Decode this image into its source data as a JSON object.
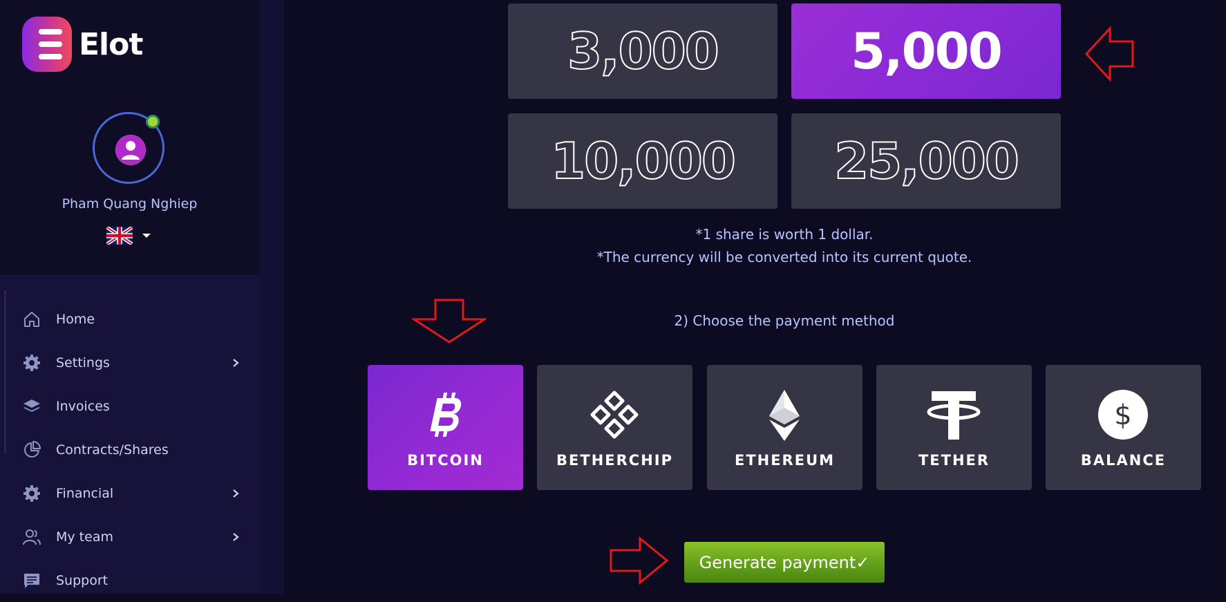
{
  "brand": {
    "name": "Elot"
  },
  "user": {
    "name": "Pham Quang Nghiep",
    "language": "English"
  },
  "sidebar": {
    "items": [
      {
        "label": "Home",
        "icon": "home-icon",
        "has_submenu": false
      },
      {
        "label": "Settings",
        "icon": "gear-icon",
        "has_submenu": true
      },
      {
        "label": "Invoices",
        "icon": "layers-icon",
        "has_submenu": false
      },
      {
        "label": "Contracts/Shares",
        "icon": "pie-chart-icon",
        "has_submenu": false
      },
      {
        "label": "Financial",
        "icon": "gear-icon",
        "has_submenu": true
      },
      {
        "label": "My team",
        "icon": "users-icon",
        "has_submenu": true
      },
      {
        "label": "Support",
        "icon": "chat-icon",
        "has_submenu": false
      }
    ]
  },
  "shares": {
    "options": [
      {
        "label": "3,000",
        "selected": false
      },
      {
        "label": "5,000",
        "selected": true
      },
      {
        "label": "10,000",
        "selected": false
      },
      {
        "label": "25,000",
        "selected": false
      }
    ],
    "note_1": "*1 share is worth 1 dollar.",
    "note_2": "*The currency will be converted into its current quote."
  },
  "payment": {
    "title": "2) Choose the payment method",
    "methods": [
      {
        "label": "BITCOIN",
        "icon": "bitcoin-icon",
        "selected": true
      },
      {
        "label": "BETHERCHIP",
        "icon": "betherchip-icon",
        "selected": false
      },
      {
        "label": "ETHEREUM",
        "icon": "ethereum-icon",
        "selected": false
      },
      {
        "label": "TETHER",
        "icon": "tether-icon",
        "selected": false
      },
      {
        "label": "BALANCE",
        "icon": "dollar-icon",
        "selected": false
      }
    ],
    "generate_label": "Generate payment✓"
  },
  "colors": {
    "accent": "#8b2ad6",
    "sidebar_bg": "#17123a",
    "card_bg": "#363545",
    "button_green": "#62a01a",
    "annotation_red": "#e0191b"
  }
}
